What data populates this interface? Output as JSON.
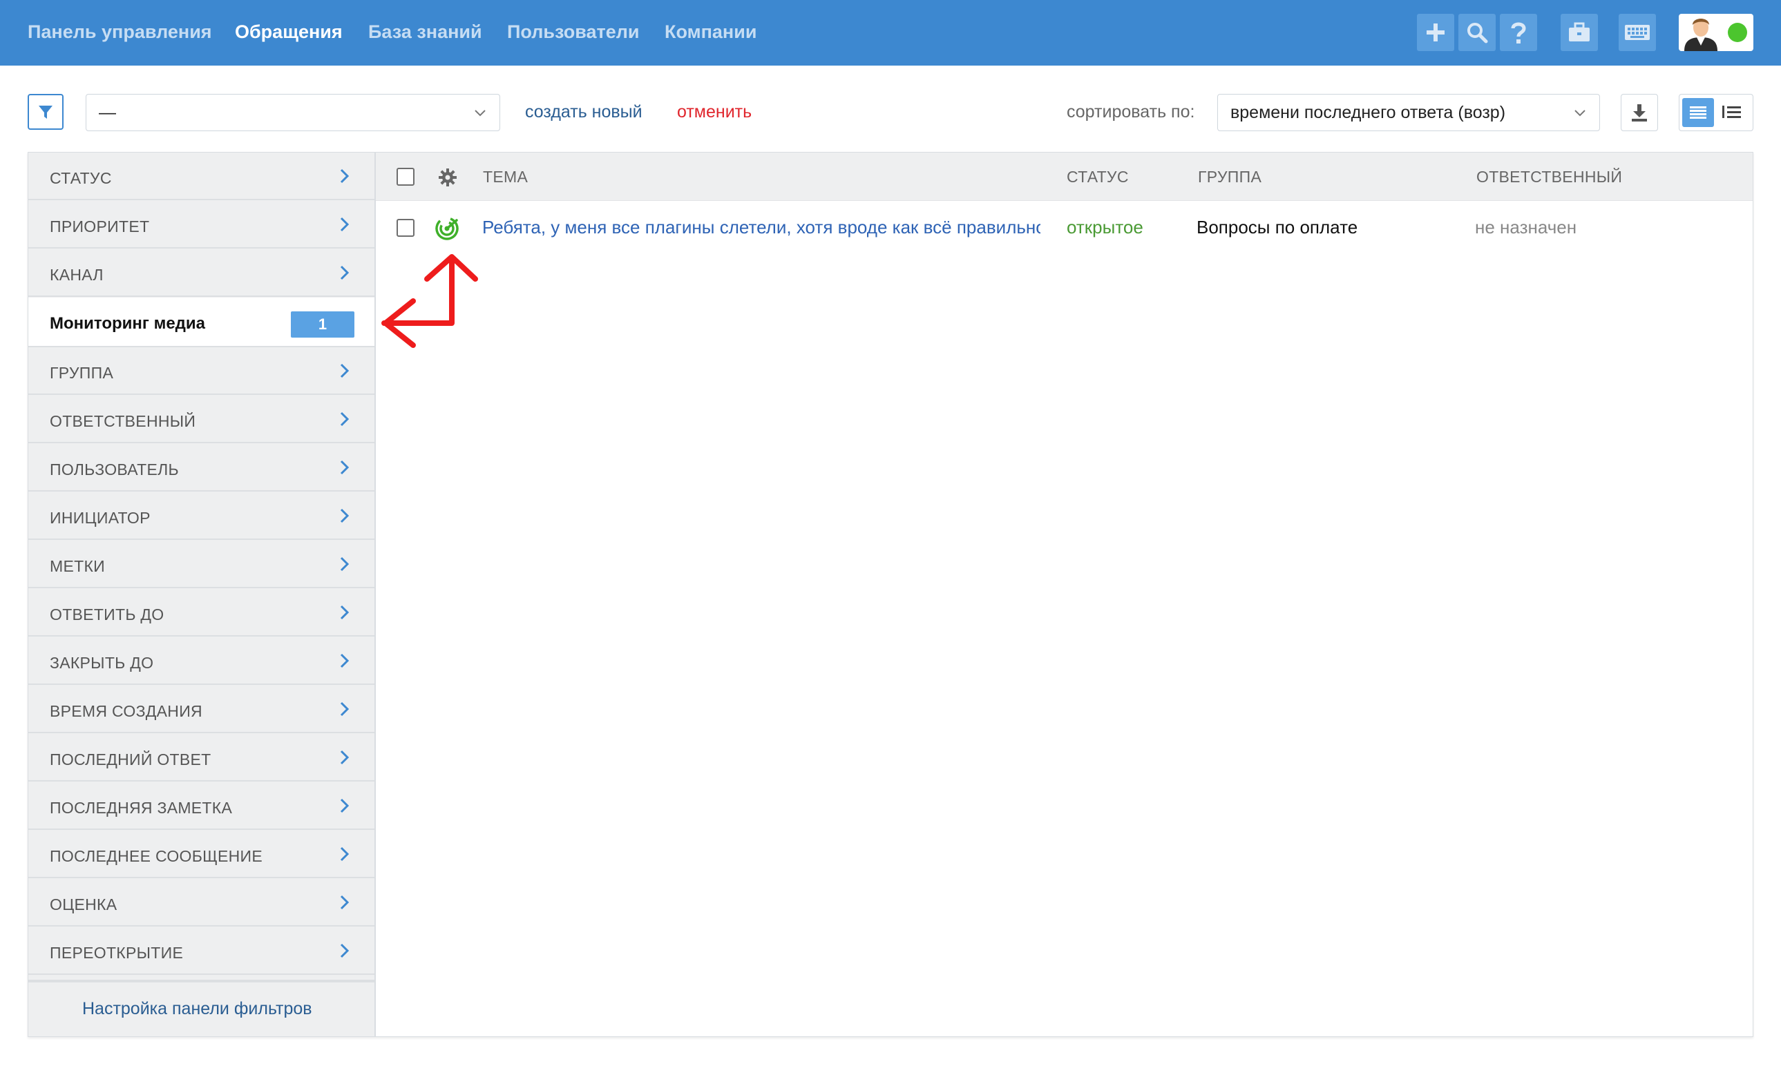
{
  "nav": {
    "items": [
      "Панель управления",
      "Обращения",
      "База знаний",
      "Пользователи",
      "Компании"
    ],
    "active_index": 1
  },
  "toolbar_icons": [
    "plus-icon",
    "search-icon",
    "help-icon",
    "briefcase-icon",
    "keyboard-icon"
  ],
  "user": {
    "online": true,
    "status_color": "#4cc52e"
  },
  "filter_bar": {
    "filter_select_value": "—",
    "create_new": "создать новый",
    "cancel": "отменить",
    "sort_label": "сортировать по:",
    "sort_value": "времени последнего ответа (возр)"
  },
  "sidebar": {
    "items": [
      {
        "label": "СТАТУС"
      },
      {
        "label": "ПРИОРИТЕТ"
      },
      {
        "label": "КАНАЛ"
      },
      {
        "label": "Мониторинг медиа",
        "count": "1",
        "active": true
      },
      {
        "label": "ГРУППА"
      },
      {
        "label": "ОТВЕТСТВЕННЫЙ"
      },
      {
        "label": "ПОЛЬЗОВАТЕЛЬ"
      },
      {
        "label": "ИНИЦИАТОР"
      },
      {
        "label": "МЕТКИ"
      },
      {
        "label": "ОТВЕТИТЬ ДО"
      },
      {
        "label": "ЗАКРЫТЬ ДО"
      },
      {
        "label": "ВРЕМЯ СОЗДАНИЯ"
      },
      {
        "label": "ПОСЛЕДНИЙ ОТВЕТ"
      },
      {
        "label": "ПОСЛЕДНЯЯ ЗАМЕТКА"
      },
      {
        "label": "ПОСЛЕДНЕЕ СООБЩЕНИЕ"
      },
      {
        "label": "ОЦЕНКА"
      },
      {
        "label": "ПЕРЕОТКРЫТИЕ"
      }
    ],
    "footer_link": "Настройка панели фильтров"
  },
  "table": {
    "headers": {
      "subject": "ТЕМА",
      "status": "СТАТУС",
      "group": "ГРУППА",
      "assignee": "ОТВЕТСТВЕННЫЙ"
    },
    "rows": [
      {
        "subject": "Ребята, у меня все плагины слетели, хотя вроде как всё правильно",
        "status": "открытое",
        "group": "Вопросы по оплате",
        "assignee": "не назначен",
        "channel_icon": "media-monitoring-icon"
      }
    ]
  },
  "colors": {
    "accent": "#3d88d0",
    "status_open": "#4a9a34",
    "annotation": "#ee1c1c"
  }
}
